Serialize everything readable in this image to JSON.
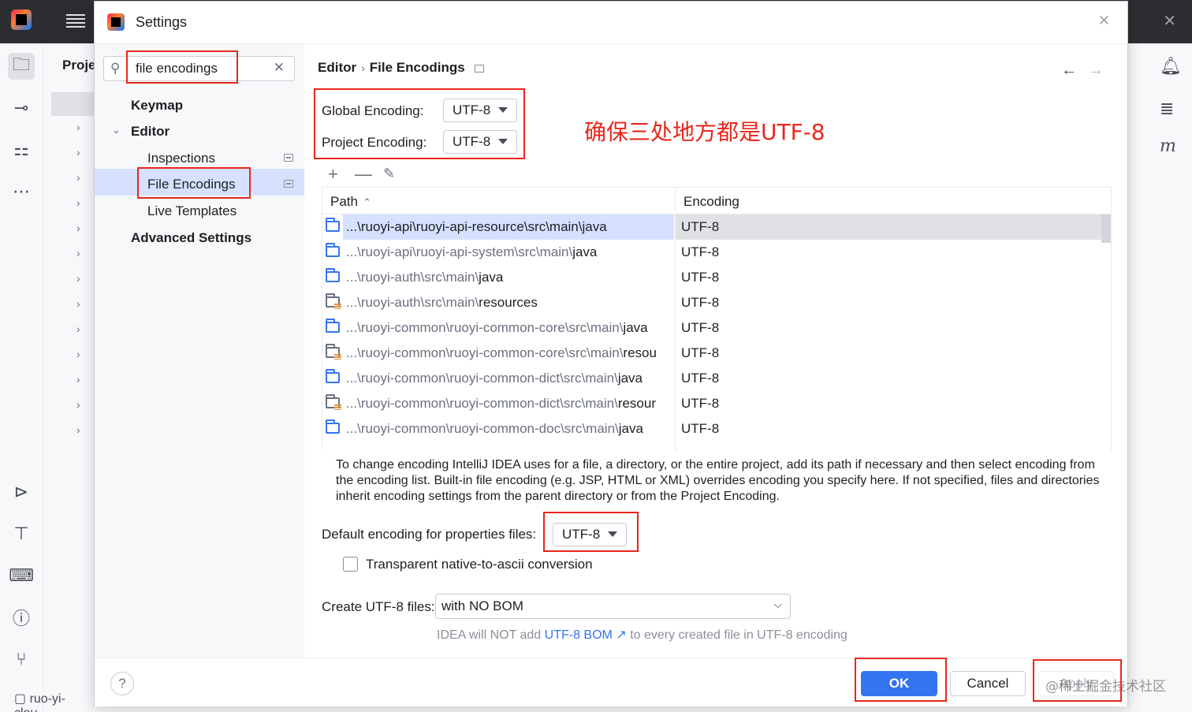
{
  "ide": {
    "project_label": "Proje",
    "status_project": "ruo-yi-clou"
  },
  "dialog": {
    "title": "Settings",
    "search": {
      "value": "file encodings",
      "placeholder": ""
    },
    "nav": [
      {
        "label": "Keymap"
      },
      {
        "label": "Editor"
      },
      {
        "label": "Inspections"
      },
      {
        "label": "File Encodings"
      },
      {
        "label": "Live Templates"
      },
      {
        "label": "Advanced Settings"
      }
    ],
    "breadcrumb": {
      "parent": "Editor",
      "sep": "›",
      "current": "File Encodings"
    },
    "global_encoding": {
      "label": "Global Encoding:",
      "value": "UTF-8"
    },
    "project_encoding": {
      "label": "Project Encoding:",
      "value": "UTF-8"
    },
    "annotation": "确保三处地方都是UTF-8",
    "table": {
      "headers": {
        "path": "Path",
        "encoding": "Encoding"
      },
      "rows": [
        {
          "dim": "...\\ruoyi-api\\ruoyi-api-resource\\src\\main\\",
          "strong": "java",
          "encoding": "UTF-8",
          "icon": "source-folder-icon"
        },
        {
          "dim": "...\\ruoyi-api\\ruoyi-api-system\\src\\main\\",
          "strong": "java",
          "encoding": "UTF-8",
          "icon": "source-folder-icon"
        },
        {
          "dim": "...\\ruoyi-auth\\src\\main\\",
          "strong": "java",
          "encoding": "UTF-8",
          "icon": "source-folder-icon"
        },
        {
          "dim": "...\\ruoyi-auth\\src\\main\\",
          "strong": "resources",
          "encoding": "UTF-8",
          "icon": "resources-folder-icon"
        },
        {
          "dim": "...\\ruoyi-common\\ruoyi-common-core\\src\\main\\",
          "strong": "java",
          "encoding": "UTF-8",
          "icon": "source-folder-icon"
        },
        {
          "dim": "...\\ruoyi-common\\ruoyi-common-core\\src\\main\\",
          "strong": "resou",
          "encoding": "UTF-8",
          "icon": "resources-folder-icon"
        },
        {
          "dim": "...\\ruoyi-common\\ruoyi-common-dict\\src\\main\\",
          "strong": "java",
          "encoding": "UTF-8",
          "icon": "source-folder-icon"
        },
        {
          "dim": "...\\ruoyi-common\\ruoyi-common-dict\\src\\main\\",
          "strong": "resour",
          "encoding": "UTF-8",
          "icon": "resources-folder-icon"
        },
        {
          "dim": "...\\ruoyi-common\\ruoyi-common-doc\\src\\main\\",
          "strong": "java",
          "encoding": "UTF-8",
          "icon": "source-folder-icon"
        }
      ]
    },
    "hint": "To change encoding IntelliJ IDEA uses for a file, a directory, or the entire project, add its path if necessary and then select encoding from the encoding list. Built-in file encoding (e.g. JSP, HTML or XML) overrides encoding you specify here. If not specified, files and directories inherit encoding settings from the parent directory or from the Project Encoding.",
    "properties_encoding": {
      "label": "Default encoding for properties files:",
      "value": "UTF-8"
    },
    "native_to_ascii": {
      "label": "Transparent native-to-ascii conversion",
      "checked": false
    },
    "create_utf8": {
      "label": "Create UTF-8 files:",
      "value": "with NO BOM"
    },
    "bom_hint": {
      "before": "IDEA will NOT add",
      "link": "UTF-8 BOM ↗",
      "after": "to every created file in UTF-8 encoding"
    },
    "buttons": {
      "help": "?",
      "ok": "OK",
      "cancel": "Cancel",
      "apply": "Apply"
    },
    "watermark": "@稀土掘金技术社区"
  },
  "colors": {
    "accent": "#3574f0",
    "annotation": "#e8271b",
    "selection": "#d5e1ff"
  }
}
